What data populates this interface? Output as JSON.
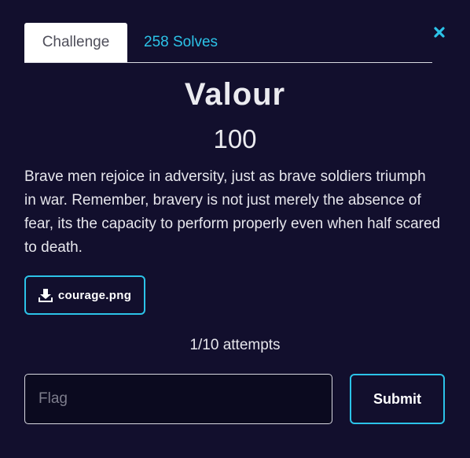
{
  "tabs": [
    {
      "label": "Challenge",
      "active": true
    },
    {
      "label": "258 Solves",
      "active": false
    }
  ],
  "challenge": {
    "name": "Valour",
    "points": "100",
    "description": "Brave men rejoice in adversity, just as brave soldiers triumph in war. Remember, bravery is not just merely the absence of fear, its the capacity to perform properly even when half scared to death.",
    "file": {
      "name": "courage.png",
      "icon": "download-icon"
    },
    "attempts": "1/10 attempts"
  },
  "form": {
    "flag_placeholder": "Flag",
    "flag_value": "",
    "submit_label": "Submit"
  },
  "icons": {
    "close": "close-icon",
    "download": "download-icon"
  },
  "colors": {
    "background": "#120f2d",
    "accent": "#2cc3e8",
    "text": "#ebebf0",
    "tab_active_bg": "#ffffff",
    "tab_active_text": "#4e4e5a"
  }
}
